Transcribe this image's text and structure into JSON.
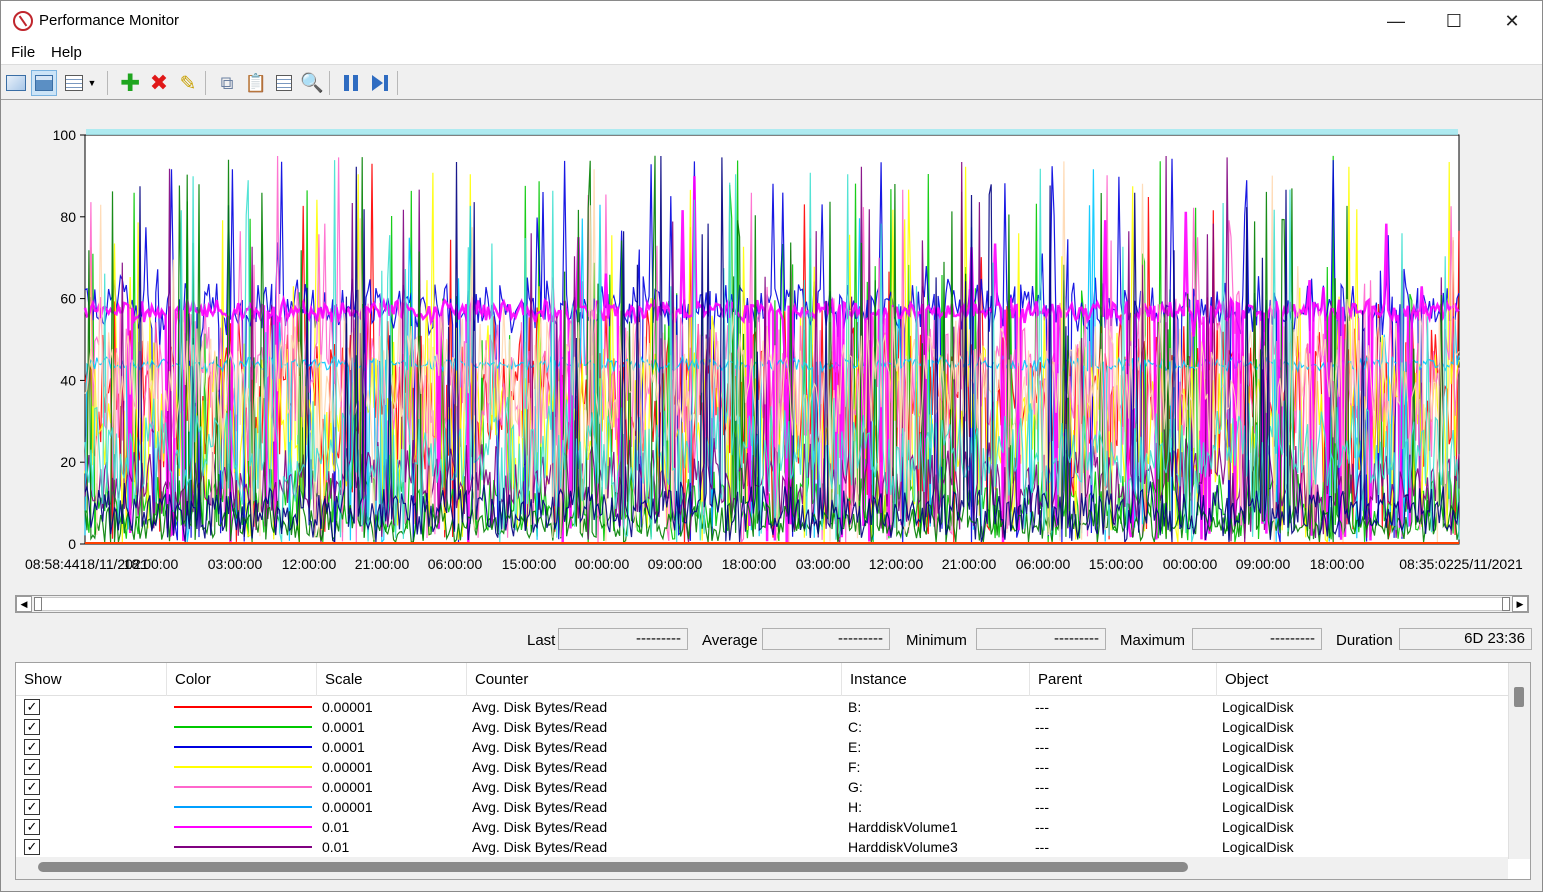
{
  "window": {
    "title": "Performance Monitor"
  },
  "menu": [
    "File",
    "Help"
  ],
  "toolbar": {
    "icons": [
      "view-graph-icon",
      "view-histogram-icon",
      "change-graph-type-icon",
      "add-counter-icon",
      "delete-counter-icon",
      "highlight-icon",
      "copy-properties-icon",
      "paste-counter-list-icon",
      "properties-icon",
      "zoom-icon",
      "freeze-display-icon",
      "update-data-icon"
    ]
  },
  "chart_data": {
    "type": "line",
    "ylim": [
      0,
      100
    ],
    "yticks": [
      "0",
      "20",
      "40",
      "60",
      "80",
      "100"
    ],
    "xticks": [
      "08:58:4418/11/2021",
      "18:00:00",
      "03:00:00",
      "12:00:00",
      "21:00:00",
      "06:00:00",
      "15:00:00",
      "00:00:00",
      "09:00:00",
      "18:00:00",
      "03:00:00",
      "12:00:00",
      "21:00:00",
      "06:00:00",
      "15:00:00",
      "00:00:00",
      "09:00:00",
      "18:00:00",
      "08:35:0225/11/2021"
    ],
    "series": [
      {
        "color": "#ff0000",
        "base": 35,
        "spread": 25,
        "spikes": 0.03
      },
      {
        "color": "#00c800",
        "base": 10,
        "spread": 10,
        "spikes": 0.09
      },
      {
        "color": "#0000e0",
        "base": 58,
        "spread": 8,
        "spikes": 0.06
      },
      {
        "color": "#ffff00",
        "base": 30,
        "spread": 25,
        "spikes": 0.05
      },
      {
        "color": "#ff66cc",
        "base": 40,
        "spread": 25,
        "spikes": 0.04
      },
      {
        "color": "#00c8ff",
        "base": 44,
        "spread": 2,
        "spikes": 0.03
      },
      {
        "color": "#ff00ff",
        "base": 57,
        "spread": 3,
        "spikes": 0.02
      },
      {
        "color": "#800080",
        "base": 15,
        "spread": 12,
        "spikes": 0.04
      },
      {
        "color": "#008000",
        "base": 5,
        "spread": 6,
        "spikes": 0.08
      },
      {
        "color": "#ffd8b0",
        "base": 40,
        "spread": 20,
        "spikes": 0.03
      },
      {
        "color": "#40e0d0",
        "base": 22,
        "spread": 15,
        "spikes": 0.04
      },
      {
        "color": "#000080",
        "base": 8,
        "spread": 8,
        "spikes": 0.05
      }
    ]
  },
  "stats": {
    "last_label": "Last",
    "last_value": "---------",
    "average_label": "Average",
    "average_value": "---------",
    "minimum_label": "Minimum",
    "minimum_value": "---------",
    "maximum_label": "Maximum",
    "maximum_value": "---------",
    "duration_label": "Duration",
    "duration_value": "6D 23:36"
  },
  "table": {
    "headers": [
      "Show",
      "Color",
      "Scale",
      "Counter",
      "Instance",
      "Parent",
      "Object"
    ],
    "rows": [
      {
        "color": "#ff0000",
        "scale": "0.00001",
        "counter": "Avg. Disk Bytes/Read",
        "instance": "B:",
        "parent": "---",
        "object": "LogicalDisk"
      },
      {
        "color": "#00c800",
        "scale": "0.0001",
        "counter": "Avg. Disk Bytes/Read",
        "instance": "C:",
        "parent": "---",
        "object": "LogicalDisk"
      },
      {
        "color": "#0000e0",
        "scale": "0.0001",
        "counter": "Avg. Disk Bytes/Read",
        "instance": "E:",
        "parent": "---",
        "object": "LogicalDisk"
      },
      {
        "color": "#ffff00",
        "scale": "0.00001",
        "counter": "Avg. Disk Bytes/Read",
        "instance": "F:",
        "parent": "---",
        "object": "LogicalDisk"
      },
      {
        "color": "#ff66cc",
        "scale": "0.00001",
        "counter": "Avg. Disk Bytes/Read",
        "instance": "G:",
        "parent": "---",
        "object": "LogicalDisk"
      },
      {
        "color": "#00a0ff",
        "scale": "0.00001",
        "counter": "Avg. Disk Bytes/Read",
        "instance": "H:",
        "parent": "---",
        "object": "LogicalDisk"
      },
      {
        "color": "#ff00ff",
        "scale": "0.01",
        "counter": "Avg. Disk Bytes/Read",
        "instance": "HarddiskVolume1",
        "parent": "---",
        "object": "LogicalDisk"
      },
      {
        "color": "#800080",
        "scale": "0.01",
        "counter": "Avg. Disk Bytes/Read",
        "instance": "HarddiskVolume3",
        "parent": "---",
        "object": "LogicalDisk"
      }
    ]
  }
}
